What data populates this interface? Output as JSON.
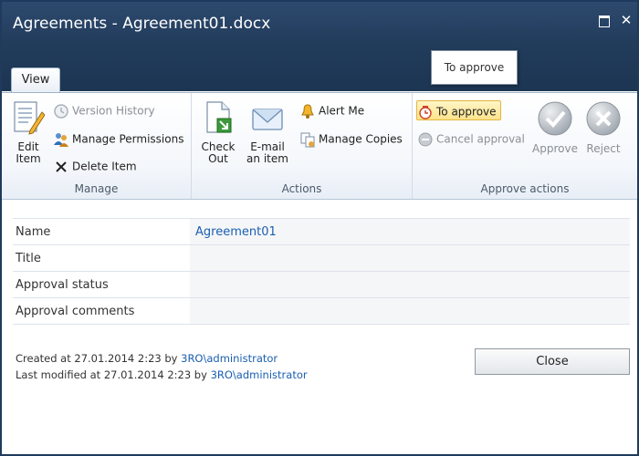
{
  "window": {
    "title": "Agreements - Agreement01.docx",
    "maximize_glyph": "",
    "close_glyph": "✕"
  },
  "tabs": [
    {
      "label": "View"
    }
  ],
  "tooltip": {
    "text": "To approve"
  },
  "ribbon": {
    "manage": {
      "label": "Manage",
      "edit_item": "Edit Item",
      "version_history": "Version History",
      "manage_permissions": "Manage Permissions",
      "delete_item": "Delete Item"
    },
    "actions": {
      "label": "Actions",
      "check_out": "Check Out",
      "email_item": "E-mail an item",
      "alert_me": "Alert Me",
      "manage_copies": "Manage Copies"
    },
    "approve": {
      "label": "Approve actions",
      "to_approve": "To approve",
      "cancel_approval": "Cancel approval",
      "approve": "Approve",
      "reject": "Reject"
    }
  },
  "properties": [
    {
      "key": "Name",
      "value": "Agreement01",
      "is_link": true
    },
    {
      "key": "Title",
      "value": "",
      "is_link": false
    },
    {
      "key": "Approval status",
      "value": "",
      "is_link": false
    },
    {
      "key": "Approval comments",
      "value": "",
      "is_link": false
    }
  ],
  "footer": {
    "created_prefix": "Created at 27.01.2014 2:23 by ",
    "created_user": "3RO\\administrator",
    "modified_prefix": "Last modified at 27.01.2014 2:23 by ",
    "modified_user": "3RO\\administrator",
    "close_label": "Close"
  },
  "colors": {
    "titlebar": "#223c5c",
    "link": "#1a5fb0",
    "highlight": "#fde48b"
  }
}
